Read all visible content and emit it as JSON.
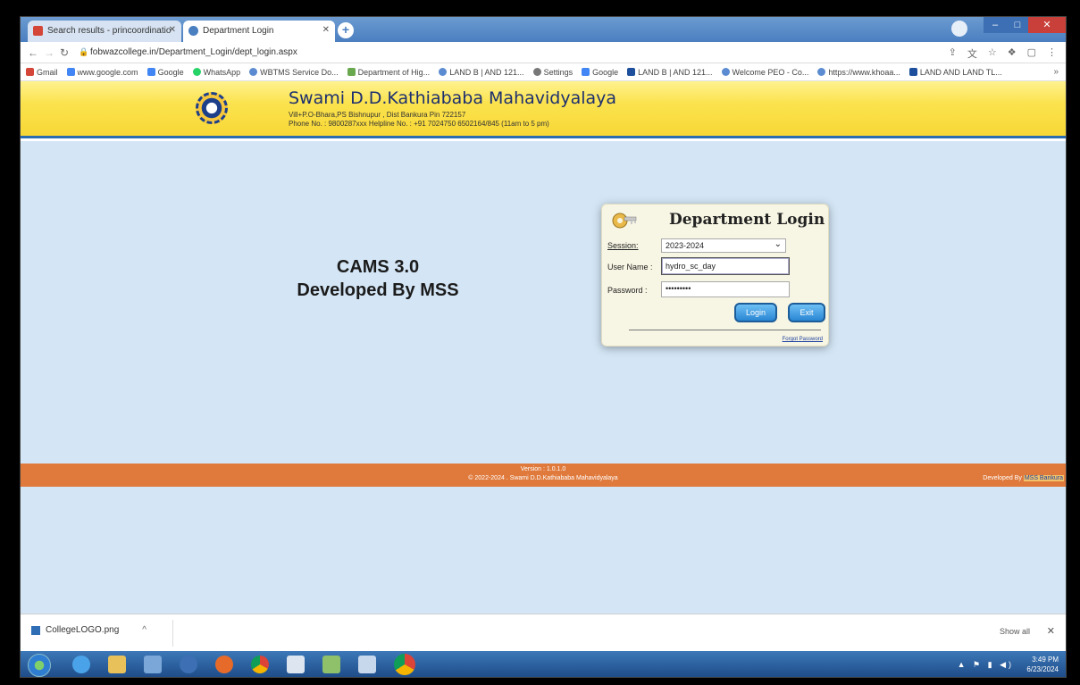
{
  "browser": {
    "tabs": [
      {
        "label": "Search results - princoordinatio"
      },
      {
        "label": "Department Login"
      }
    ],
    "address": "fobwazcollege.in/Department_Login/dept_login.aspx",
    "bookmarks": [
      "Gmail",
      "www.google.com",
      "Google",
      "WhatsApp",
      "WBTMS Service Do...",
      "Department of Hig...",
      "LAND B | AND 121...",
      "Settings",
      "Google",
      "LAND B | AND 121...",
      "Welcome PEO - Co...",
      "https://www.khoaa...",
      "LAND AND LAND TL..."
    ]
  },
  "site": {
    "name": "Swami D.D.Kathiababa Mahavidyalaya",
    "address": "Vill+P.O-Bhara,PS Bishnupur , Dist Bankura Pin 722157",
    "phone": "Phone No. : 9800287xxx  Helpline No. : +91 7024750 6502164/845 (11am to 5 pm)"
  },
  "main": {
    "cams_line1": "CAMS 3.0",
    "cams_line2": "Developed By MSS"
  },
  "login": {
    "title": "Department Login",
    "session_label": "Session:",
    "session_value": "2023-2024",
    "username_label": "User Name :",
    "username_value": "hydro_sc_day",
    "password_label": "Password :",
    "password_value": "•••••••••",
    "login_button": "Login",
    "exit_button": "Exit",
    "forget_link": "Forgot Password"
  },
  "footer": {
    "version": "Version : 1.0.1.0",
    "copyright": "© 2022-2024 . Swami D.D.Kathiababa Mahavidyalaya",
    "developed_by": "Developed By",
    "developer": "MSS Bankura"
  },
  "downloads": {
    "item": "CollegeLOGO.png",
    "show_all": "Show all"
  },
  "taskbar": {
    "time": "3:49 PM",
    "date": "6/23/2024"
  }
}
